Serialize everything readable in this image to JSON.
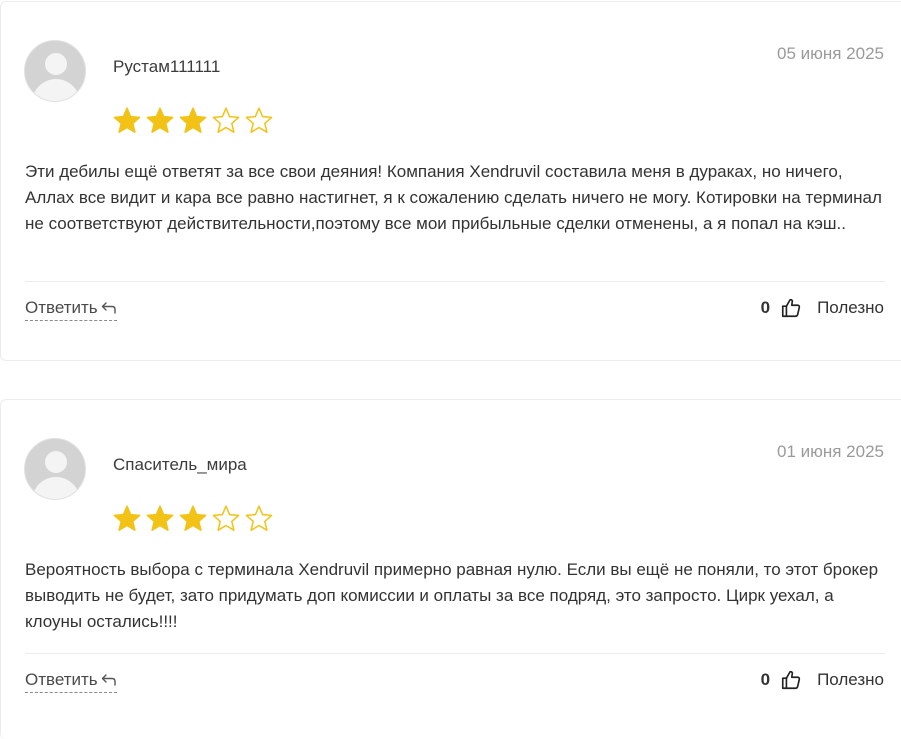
{
  "reviews": [
    {
      "author": "Рустам111111",
      "date": "05 июня 2025",
      "rating": 3,
      "max_rating": 5,
      "text": "Эти дебилы ещё ответят за все свои деяния! Компания Xendruvil составила меня в дураках, но ничего, Аллах все видит и кара все равно настигнет, я к сожалению сделать ничего не могу. Котировки на терминал не соответствуют действительности,поэтому все мои прибыльные сделки отменены, а я попал на кэш..",
      "reply_label": "Ответить",
      "useful_count": "0",
      "useful_label": "Полезно"
    },
    {
      "author": "Спаситель_мира",
      "date": "01 июня 2025",
      "rating": 3,
      "max_rating": 5,
      "text": "Вероятность выбора с терминала Xendruvil примерно равная нулю. Если вы ещё не поняли, то этот брокер выводить не будет, зато придумать доп комиссии и оплаты за все подряд, это запросто. Цирк уехал, а клоуны остались!!!!",
      "reply_label": "Ответить",
      "useful_count": "0",
      "useful_label": "Полезно"
    }
  ],
  "colors": {
    "star_filled": "#F2C316",
    "star_empty_stroke": "#F2C316",
    "date": "#9a9a9a",
    "border": "#ececec"
  },
  "icons": {
    "star": "star-icon",
    "reply": "reply-arrow-icon",
    "thumb": "thumbs-up-icon",
    "avatar": "user-avatar-icon"
  }
}
